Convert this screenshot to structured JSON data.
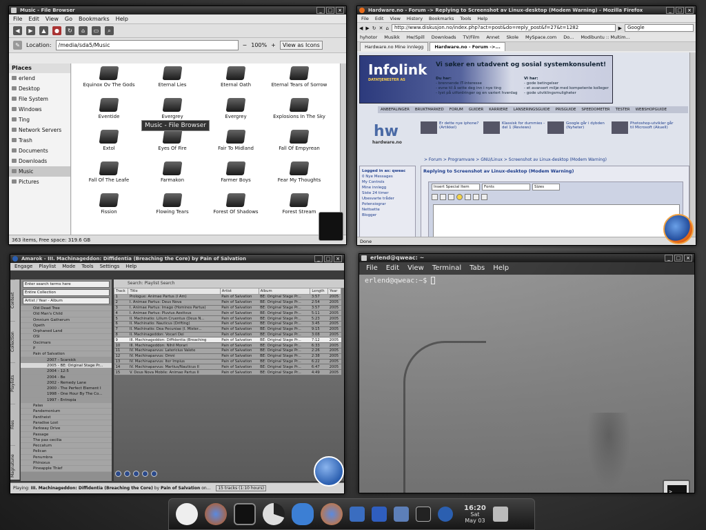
{
  "file_browser": {
    "title": "Music - File Browser",
    "menu": [
      "File",
      "Edit",
      "View",
      "Go",
      "Bookmarks",
      "Help"
    ],
    "location_label": "Location:",
    "location": "/media/sda5/Music",
    "zoom": "100%",
    "view_mode": "View as Icons",
    "places_label": "Places",
    "places": [
      "erlend",
      "Desktop",
      "File System",
      "Windows",
      "Ting",
      "Network Servers",
      "Trash",
      "Documents",
      "Downloads",
      "Music",
      "Pictures"
    ],
    "selected_place": "Music",
    "folders": [
      "Equinox Ov The Gods",
      "Eternal Lies",
      "Eternal Oath",
      "Eternal Tears of Sorrow",
      "Eventide",
      "Evergrey",
      "Evergrey",
      "Explosions In The Sky",
      "Extol",
      "Eyes Of Fire",
      "Fair To Midland",
      "Fall Of Empyrean",
      "Fall Of The Leafe",
      "Farmakon",
      "Farmer Boys",
      "Fear My Thoughts",
      "Fission",
      "Flowing Tears",
      "Forest Of Shadows",
      "Forest Stream"
    ],
    "tooltip": "Music - File Browser",
    "status": "363 items, Free space: 319.6 GB"
  },
  "firefox": {
    "title": "Hardware.no - Forum -> Replying to Screenshot av Linux-desktop (Modem Warning) - Mozilla Firefox",
    "menu": [
      "File",
      "Edit",
      "View",
      "History",
      "Bookmarks",
      "Tools",
      "Help"
    ],
    "url": "http://www.diskusjon.no/index.php?act=post&do=reply_post&f=27&t=1282",
    "search_placeholder": "Google",
    "bookmarks": [
      "hyhotor",
      "Musikk",
      "Hw/Spill",
      "Downloads",
      "TV/Film",
      "Annet",
      "Skole",
      "MySpace.com",
      "Do...",
      "Modibuntu :: Multim..."
    ],
    "tabs": [
      "Hardware.no  Mine innlegg",
      "Hardware.no - Forum ->..."
    ],
    "banner_logo": "Infolink",
    "banner_sub": "DATATJENESTER AS",
    "banner_headline": "Vi søker en utadvent og sosial systemkonsulent!",
    "banner_col1_title": "Du har:",
    "banner_col1": [
      "- brennende IT-interesse",
      "- evne til å sette deg inn i nye ting",
      "- lyst på utfordringer og en variert hverdag"
    ],
    "banner_col2_title": "Vi har:",
    "banner_col2": [
      "- gode betingelser",
      "- et avansert miljø med kompetente kolleger",
      "- gode utviklingsmuligheter"
    ],
    "nav": [
      "ANBEFALINGER",
      "BRUKTMARKED",
      "FORUM",
      "GUIDER",
      "KARRIERE",
      "LANSERINGSGUIDE",
      "PRISGUIDE",
      "SPEEDOMETER",
      "TESTER",
      "WEBSHOPGUIDE"
    ],
    "site_logo": "hw",
    "site_name": "hardware.no",
    "news": [
      {
        "text": "Er dette nye iphone? (Artikkel)"
      },
      {
        "text": "Klassisk for dummies - del 1 (Reviews)"
      },
      {
        "text": "Google går i dybden (Nyheter)"
      },
      {
        "text": "Photoshop-utvikler går til Microsoft (Akuell)"
      }
    ],
    "breadcrumb": "> Forum > Programvare > GNU/Linux > Screenshot av Linux-desktop (Modem Warning)",
    "login_label": "Logged in as: qweac",
    "left_links": [
      "0 Nye Messages",
      "My Controls",
      "Mine innlegg",
      "Siste 24 timer",
      "Ubesvarte tråder",
      "Potensiograr",
      "Nettsette",
      "Blogger"
    ],
    "reply_title": "Replying to Screenshot av Linux-desktop (Modem Warning)",
    "editor_special": "Insert Special Item",
    "editor_fonts": "Fonts",
    "editor_sizes": "Sizes",
    "status": "Done"
  },
  "amarok": {
    "title": "Amarok - III. Machinageddon: Diffidentia (Breaching the Core) by Pain of Salvation",
    "menu": [
      "Engage",
      "Playlist",
      "Mode",
      "Tools",
      "Settings",
      "Help"
    ],
    "collection_filter": "Enter search terms here",
    "collection": "Entire Collection",
    "grouping": "Artist / Year - Album",
    "sidetabs": [
      "Context",
      "Collection",
      "Playlists",
      "Files",
      "Magnatune",
      "Devices"
    ],
    "tree": [
      {
        "t": "Old Dead Tree",
        "k": "art"
      },
      {
        "t": "Old Man's Child",
        "k": "art"
      },
      {
        "t": "Omnium Gatherum",
        "k": "art"
      },
      {
        "t": "Opeth",
        "k": "art"
      },
      {
        "t": "Orphaned Land",
        "k": "art"
      },
      {
        "t": "OSI",
        "k": "art"
      },
      {
        "t": "Oscimars",
        "k": "art"
      },
      {
        "t": "P",
        "k": "art"
      },
      {
        "t": "Pain of Salvation",
        "k": "art"
      },
      {
        "t": "2007 - Scarsick",
        "k": "alb"
      },
      {
        "t": "2005 - BE: Original Stage Pr...",
        "k": "sel"
      },
      {
        "t": "2004 - 12:5",
        "k": "alb"
      },
      {
        "t": "2004 - Be",
        "k": "alb"
      },
      {
        "t": "2002 - Remedy Lane",
        "k": "alb"
      },
      {
        "t": "2000 - The Perfect Element I",
        "k": "alb"
      },
      {
        "t": "1998 - One Hour By The Co...",
        "k": "alb"
      },
      {
        "t": "1997 - Entropia",
        "k": "alb"
      },
      {
        "t": "Palas",
        "k": "art"
      },
      {
        "t": "Pandemonium",
        "k": "art"
      },
      {
        "t": "Pantheist",
        "k": "art"
      },
      {
        "t": "Paradise Lost",
        "k": "art"
      },
      {
        "t": "Parkway Drive",
        "k": "art"
      },
      {
        "t": "Passage",
        "k": "art"
      },
      {
        "t": "The pax cecilia",
        "k": "art"
      },
      {
        "t": "Peccatum",
        "k": "art"
      },
      {
        "t": "Pelican",
        "k": "art"
      },
      {
        "t": "Penumbra",
        "k": "art"
      },
      {
        "t": "Phinoxus",
        "k": "art"
      },
      {
        "t": "Pineapple Thief",
        "k": "art"
      }
    ],
    "search_label": "Search:",
    "search_placeholder": "Playlist Search",
    "columns": [
      "Track",
      "Title",
      "Artist",
      "Album",
      "Length",
      "Year"
    ],
    "tracks": [
      [
        "1",
        "Prologue: Animae Partus (I Am)",
        "Pain of Salvation",
        "BE: Original Stage Pr...",
        "3:57",
        "2005"
      ],
      [
        "2",
        "I. Animae Partus: Deus Nova",
        "Pain of Salvation",
        "BE: Original Stage Pr...",
        "2:54",
        "2005"
      ],
      [
        "3",
        "I. Animae Partus: Imago (Homines Partus)",
        "Pain of Salvation",
        "BE: Original Stage Pr...",
        "3:57",
        "2005"
      ],
      [
        "4",
        "I. Animae Partus: Pluvius Aestivus",
        "Pain of Salvation",
        "BE: Original Stage Pr...",
        "5:11",
        "2005"
      ],
      [
        "5",
        "II. Machinatio: Lilium Cruentus (Deus N...",
        "Pain of Salvation",
        "BE: Original Stage Pr...",
        "5:23",
        "2005"
      ],
      [
        "6",
        "II. Machinatio: Nauticus (Drifting)",
        "Pain of Salvation",
        "BE: Original Stage Pr...",
        "3:45",
        "2005"
      ],
      [
        "7",
        "II. Machinatio: Dea Pecuniae (I. Mister...",
        "Pain of Salvation",
        "BE: Original Stage Pr...",
        "9:15",
        "2005"
      ],
      [
        "8",
        "II. Machinageddon: Vocari Dei",
        "Pain of Salvation",
        "BE: Original Stage Pr...",
        "3:08",
        "2005"
      ],
      [
        "9",
        "III. Machinageddon: Diffidentia (Breaching",
        "Pain of Salvation",
        "BE: Original Stage Pr...",
        "7:12",
        "2005"
      ],
      [
        "10",
        "III. Machinageddon: Nihil Morari",
        "Pain of Salvation",
        "BE: Original Stage Pr...",
        "6:33",
        "2005"
      ],
      [
        "11",
        "IV. Machinaparvus: Latericius Valete",
        "Pain of Salvation",
        "BE: Original Stage Pr...",
        "2:26",
        "2005"
      ],
      [
        "12",
        "IV. Machinaparvus: Omni",
        "Pain of Salvation",
        "BE: Original Stage Pr...",
        "2:38",
        "2005"
      ],
      [
        "13",
        "IV. Machinaparvus: Iter Impius",
        "Pain of Salvation",
        "BE: Original Stage Pr...",
        "6:22",
        "2005"
      ],
      [
        "14",
        "IV. Machinaparvus: Martius/Nauticus II",
        "Pain of Salvation",
        "BE: Original Stage Pr...",
        "6:47",
        "2005"
      ],
      [
        "15",
        "V. Deus Nova Mobile: Animae Partus II",
        "Pain of Salvation",
        "BE: Original Stage Pr...",
        "4:49",
        "2005"
      ]
    ],
    "current_track_index": 8,
    "status_prefix": "Playing:",
    "status_track": "III. Machinageddon: Diffidentia (Breaching the Core)",
    "status_by": "by",
    "status_artist": "Pain of Salvation",
    "status_suffix": "on...",
    "track_count": "15 tracks (1:10 hours)"
  },
  "terminal": {
    "title": "erlend@qweac: ~",
    "menu": [
      "File",
      "Edit",
      "View",
      "Terminal",
      "Tabs",
      "Help"
    ],
    "prompt": "erlend@qweac:~$"
  },
  "dock": {
    "time": "16:20",
    "day": "Sat",
    "date": "May 03"
  },
  "colors": {
    "accent_blue": "#2b5fb0",
    "firefox_orange": "#e76b1a",
    "selection_gray": "#c8c8c8"
  }
}
